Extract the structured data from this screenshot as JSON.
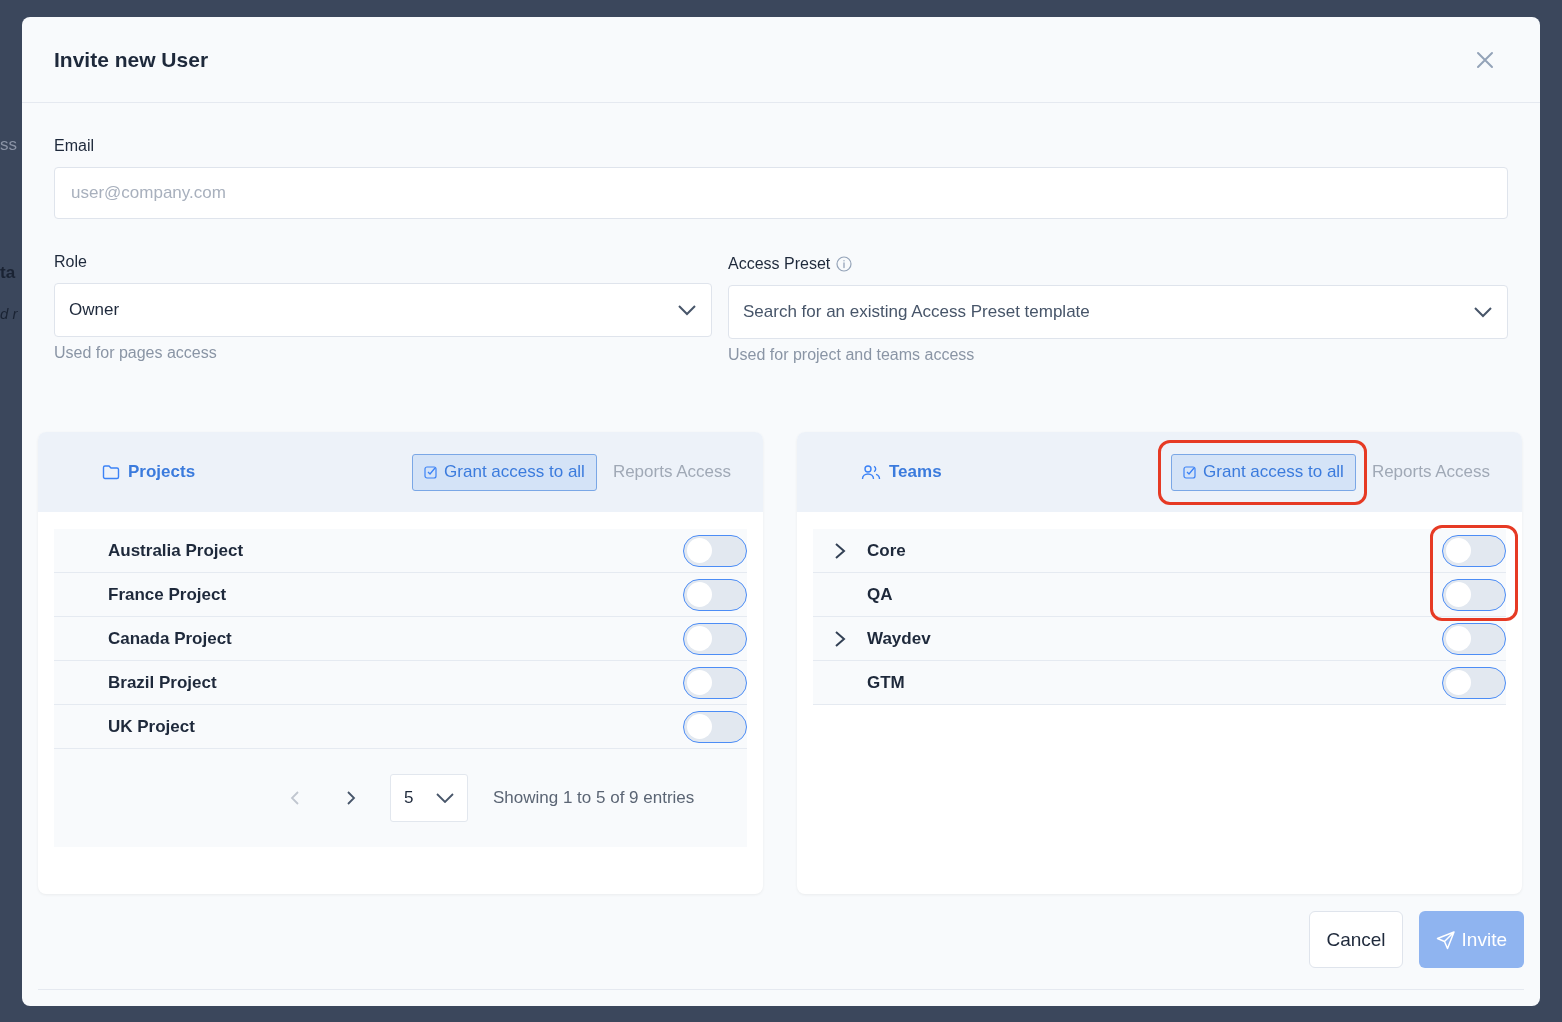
{
  "background": {
    "fragments": [
      {
        "text": "ss",
        "kind": "faint"
      },
      {
        "text": "ta",
        "kind": "bold"
      },
      {
        "text": "d r",
        "kind": "italic"
      }
    ]
  },
  "dialog": {
    "title": "Invite new User"
  },
  "email": {
    "label": "Email",
    "placeholder": "user@company.com"
  },
  "role": {
    "label": "Role",
    "value": "Owner",
    "hint": "Used for pages access"
  },
  "access_preset": {
    "label": "Access Preset",
    "placeholder": "Search for an existing Access Preset template",
    "hint": "Used for project and teams access"
  },
  "panels": [
    {
      "kind": "projects",
      "title": "Projects",
      "grant_button": "Grant access to all",
      "grant_highlighted": false,
      "reports_tab": "Reports Access",
      "items": [
        {
          "name": "Australia Project",
          "on": false,
          "expandable": false,
          "highlighted": false
        },
        {
          "name": "France Project",
          "on": false,
          "expandable": false,
          "highlighted": false
        },
        {
          "name": "Canada Project",
          "on": false,
          "expandable": false,
          "highlighted": false
        },
        {
          "name": "Brazil Project",
          "on": false,
          "expandable": false,
          "highlighted": false
        },
        {
          "name": "UK Project",
          "on": false,
          "expandable": false,
          "highlighted": false
        }
      ],
      "pagination": {
        "prev_disabled": true,
        "next_disabled": false,
        "page_size": "5",
        "summary": "Showing 1 to 5 of 9 entries"
      }
    },
    {
      "kind": "teams",
      "title": "Teams",
      "grant_button": "Grant access to all",
      "grant_highlighted": true,
      "reports_tab": "Reports Access",
      "items": [
        {
          "name": "Core",
          "on": false,
          "expandable": true,
          "highlighted": true
        },
        {
          "name": "QA",
          "on": false,
          "expandable": false,
          "highlighted": true
        },
        {
          "name": "Waydev",
          "on": false,
          "expandable": true,
          "highlighted": false
        },
        {
          "name": "GTM",
          "on": false,
          "expandable": false,
          "highlighted": false
        }
      ]
    }
  ],
  "buttons": {
    "cancel": "Cancel",
    "invite": "Invite",
    "invite_disabled": true
  }
}
